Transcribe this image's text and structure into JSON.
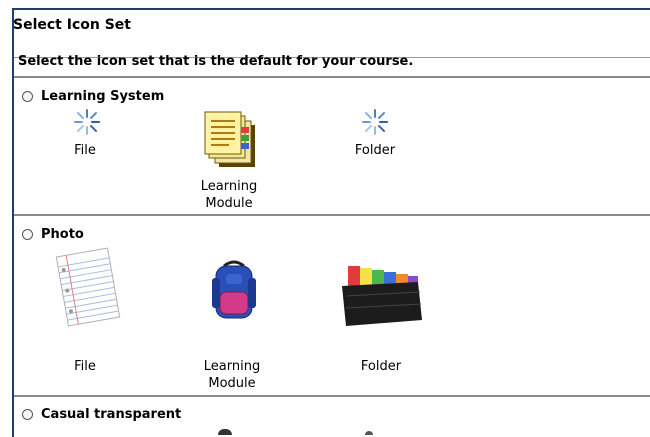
{
  "page": {
    "title": "Select Icon Set",
    "instruction": "Select the icon set that is the default for your course."
  },
  "sets": [
    {
      "label": "Learning System",
      "file": "File",
      "module_line1": "Learning",
      "module_line2": "Module",
      "folder": "Folder"
    },
    {
      "label": "Photo",
      "file": "File",
      "module_line1": "Learning",
      "module_line2": "Module",
      "folder": "Folder"
    },
    {
      "label": "Casual transparent"
    }
  ],
  "colors": {
    "frame_border": "#1a3f73",
    "rule": "#9a9a9a"
  },
  "icons": [
    "spinner-icon",
    "learning-module-icon",
    "spinner-icon",
    "notebook-paper-icon",
    "backpack-icon",
    "file-sorter-icon"
  ]
}
